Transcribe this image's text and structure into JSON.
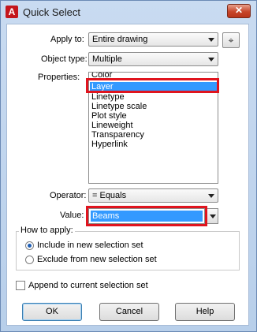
{
  "window": {
    "title": "Quick Select",
    "app_icon_glyph": "A",
    "close_glyph": "✕"
  },
  "apply_to": {
    "label": "Apply to:",
    "value": "Entire drawing",
    "pick_icon": "pick-objects-icon"
  },
  "object_type": {
    "label": "Object type:",
    "value": "Multiple"
  },
  "properties": {
    "label": "Properties:",
    "items": [
      "Color",
      "Layer",
      "Linetype",
      "Linetype scale",
      "Plot style",
      "Lineweight",
      "Transparency",
      "Hyperlink"
    ],
    "selected": "Layer"
  },
  "operator": {
    "label": "Operator:",
    "value": "= Equals"
  },
  "value": {
    "label": "Value:",
    "current": "Beams"
  },
  "how_to_apply": {
    "title": "How to apply:",
    "include_label": "Include in new selection set",
    "exclude_label": "Exclude from new selection set",
    "selected": "include"
  },
  "append": {
    "label": "Append to current selection set",
    "checked": false
  },
  "buttons": {
    "ok": "OK",
    "cancel": "Cancel",
    "help": "Help"
  },
  "highlight_color": "#e0141e",
  "selection_color": "#3399ff"
}
